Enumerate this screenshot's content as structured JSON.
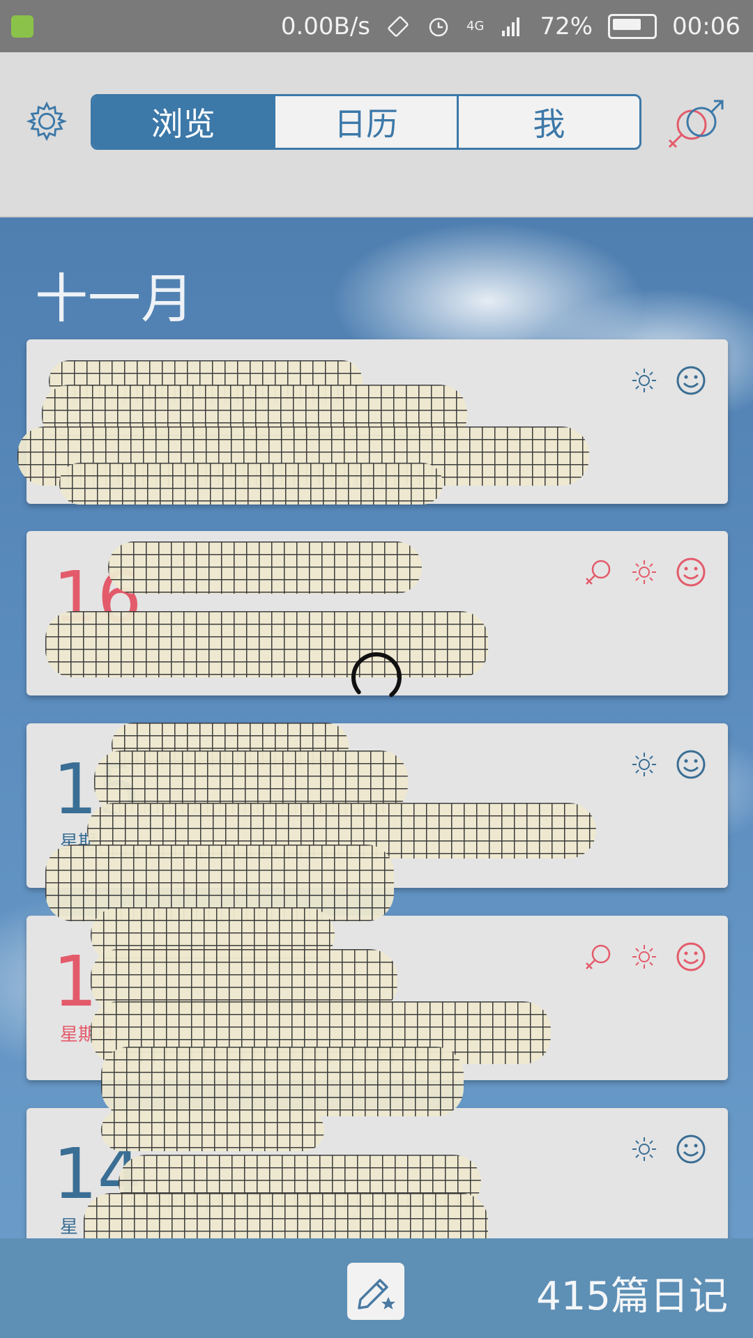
{
  "status_bar": {
    "network_speed": "0.00B/s",
    "network_type": "4G",
    "battery_percent": "72%",
    "time": "00:06"
  },
  "header": {
    "tabs": [
      {
        "label": "浏览",
        "active": true
      },
      {
        "label": "日历",
        "active": false
      },
      {
        "label": "我",
        "active": false
      }
    ],
    "settings_icon": "gear-icon",
    "gender_icon": "gender-icon"
  },
  "content": {
    "month_label": "十一月",
    "entries": [
      {
        "day": "",
        "weekday": "",
        "color": "blue",
        "icons": [
          "sun-icon",
          "smile-icon"
        ]
      },
      {
        "day": "16",
        "weekday": "",
        "color": "red",
        "icons": [
          "female-icon",
          "sun-icon",
          "smile-icon"
        ]
      },
      {
        "day": "15",
        "weekday": "星期",
        "color": "blue",
        "icons": [
          "sun-icon",
          "smile-icon"
        ]
      },
      {
        "day": "1",
        "weekday": "星期日",
        "color": "red",
        "icons": [
          "female-icon",
          "sun-icon",
          "smile-icon"
        ]
      },
      {
        "day": "14",
        "weekday": "星",
        "color": "blue",
        "icons": [
          "sun-icon",
          "smile-icon"
        ]
      }
    ]
  },
  "bottom_bar": {
    "compose_icon": "pencil-star-icon",
    "diary_count": "415篇日记"
  },
  "colors": {
    "accent_blue": "#3c78a8",
    "accent_red": "#e35b6b",
    "bottom_bar": "#5e8fb5"
  }
}
